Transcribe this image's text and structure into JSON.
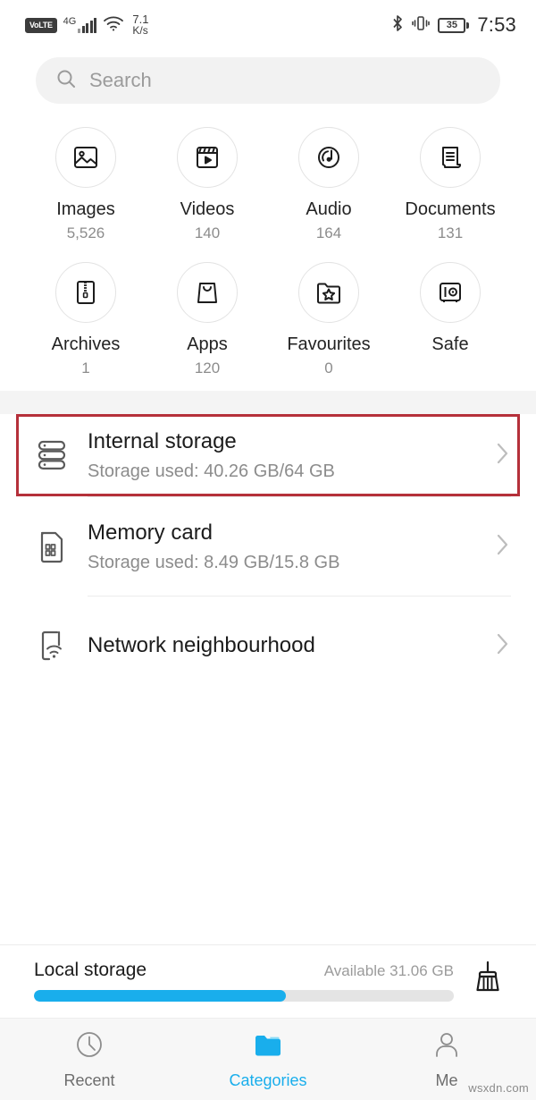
{
  "status_bar": {
    "volte": "VoLTE",
    "network": "4G",
    "signal_bars": 5,
    "wifi": "wifi-icon",
    "speed_value": "7.1",
    "speed_unit": "K/s",
    "bluetooth": "bluetooth-icon",
    "ringer_mode": "vibrate-icon",
    "battery_percent": "35",
    "time": "7:53"
  },
  "search": {
    "placeholder": "Search",
    "value": "",
    "icon": "search-icon"
  },
  "categories": [
    {
      "label": "Images",
      "count": "5,526",
      "icon": "image-icon"
    },
    {
      "label": "Videos",
      "count": "140",
      "icon": "video-icon"
    },
    {
      "label": "Audio",
      "count": "164",
      "icon": "audio-disc-icon"
    },
    {
      "label": "Documents",
      "count": "131",
      "icon": "document-icon"
    },
    {
      "label": "Archives",
      "count": "1",
      "icon": "archive-zip-icon"
    },
    {
      "label": "Apps",
      "count": "120",
      "icon": "app-bag-icon"
    },
    {
      "label": "Favourites",
      "count": "0",
      "icon": "favourite-folder-icon"
    },
    {
      "label": "Safe",
      "count": "",
      "icon": "safe-vault-icon"
    }
  ],
  "storage_items": [
    {
      "title": "Internal storage",
      "subtitle": "Storage used: 40.26 GB/64 GB",
      "icon": "server-stack-icon",
      "highlighted": true
    },
    {
      "title": "Memory card",
      "subtitle": "Storage used: 8.49 GB/15.8 GB",
      "icon": "memory-card-icon",
      "highlighted": false
    },
    {
      "title": "Network neighbourhood",
      "subtitle": "",
      "icon": "network-phone-icon",
      "highlighted": false
    }
  ],
  "local_storage": {
    "label": "Local storage",
    "available": "Available 31.06 GB",
    "used_percent": 60,
    "cleanup_icon": "broom-icon"
  },
  "tabs": [
    {
      "label": "Recent",
      "icon": "clock-icon",
      "active": false
    },
    {
      "label": "Categories",
      "icon": "folder-icon",
      "active": true
    },
    {
      "label": "Me",
      "icon": "person-icon",
      "active": false
    }
  ],
  "watermark": "wsxdn.com",
  "colors": {
    "accent": "#19aeec",
    "highlight_border": "#b5303a",
    "muted_text": "#8c8c8c",
    "track": "#e4e4e4"
  }
}
